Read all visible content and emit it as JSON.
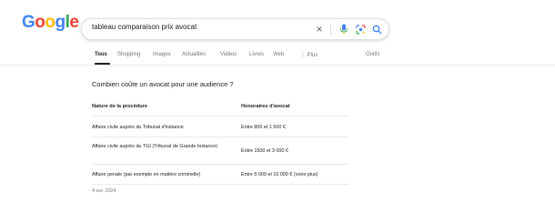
{
  "logo": {
    "letters": [
      "G",
      "o",
      "o",
      "g",
      "l",
      "e"
    ]
  },
  "search": {
    "query": "tableau comparaison prix avocat",
    "clear_icon": "×"
  },
  "tabs": [
    {
      "label": "Tous",
      "active": true
    },
    {
      "label": "Shopping",
      "active": false
    },
    {
      "label": "Images",
      "active": false
    },
    {
      "label": "Actualités",
      "active": false
    },
    {
      "label": "Vidéos",
      "active": false
    },
    {
      "label": "Livres",
      "active": false
    },
    {
      "label": "Web",
      "active": false
    },
    {
      "label": "⋮ Plus",
      "active": false
    },
    {
      "label": "Outils",
      "active": false
    }
  ],
  "snippet": {
    "question": "Combien coûte un avocat pour une audience ?",
    "headers": [
      "Nature de la procédure",
      "Honoraires d'avocat"
    ],
    "rows": [
      [
        "Affaire civile auprès du Tribunal d'instance",
        "Entre 800 et 1 500 €"
      ],
      [
        "Affaire civile auprès du TGI (Tribunal de Grande Instance)",
        "Entre 1500 et 3 000 €"
      ],
      [
        "Affaire penale (par exemple en matière criminelle)",
        "Entre 5 000 et 10 000 € (voire plus)"
      ]
    ],
    "date": "4 avr. 2024"
  },
  "colors": {
    "google_blue": "#4285f4",
    "google_red": "#ea4335",
    "google_yellow": "#fbbc05",
    "google_green": "#34a853",
    "muted_text": "#70757a"
  },
  "icons": {
    "clear": "close-icon",
    "mic": "microphone-icon",
    "lens": "google-lens-icon",
    "search": "search-icon"
  }
}
